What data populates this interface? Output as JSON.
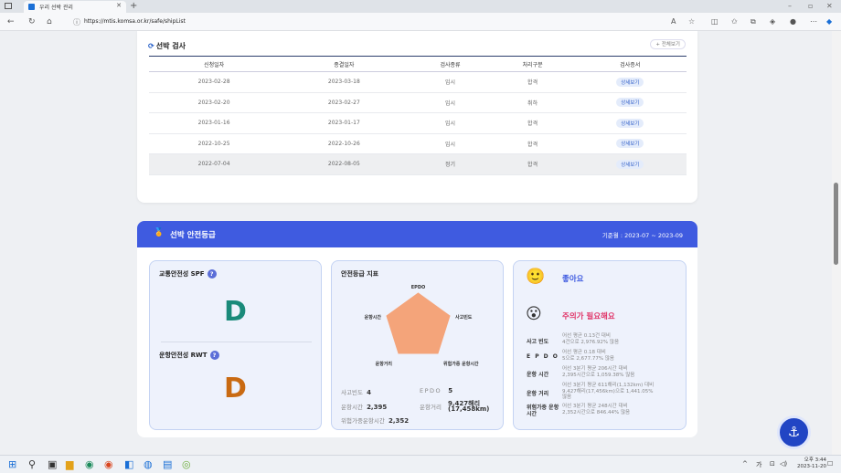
{
  "browser": {
    "tab_title": "우리 선박 관리",
    "url": "https://mtis.komsa.or.kr/safe/shipList"
  },
  "inspection": {
    "title": "선박 검사",
    "more_label": "+ 전체보기",
    "columns": [
      "신청일자",
      "종결일자",
      "검사종류",
      "처리구분",
      "검사증서"
    ],
    "rows": [
      {
        "apply": "2023-02-28",
        "close": "2023-03-18",
        "type": "임시",
        "status": "합격",
        "cert": "상세보기"
      },
      {
        "apply": "2023-02-20",
        "close": "2023-02-27",
        "type": "임시",
        "status": "취하",
        "cert": "상세보기"
      },
      {
        "apply": "2023-01-16",
        "close": "2023-01-17",
        "type": "임시",
        "status": "합격",
        "cert": "상세보기"
      },
      {
        "apply": "2022-10-25",
        "close": "2022-10-26",
        "type": "임시",
        "status": "합격",
        "cert": "상세보기"
      },
      {
        "apply": "2022-07-04",
        "close": "2022-08-05",
        "type": "정기",
        "status": "합격",
        "cert": "상세보기"
      }
    ]
  },
  "safety": {
    "title": "선박 안전등급",
    "period": "기준월 : 2023-07 ~ 2023-09",
    "spf": {
      "label": "교통안전성 SPF",
      "grade": "D",
      "help": "?"
    },
    "rwt": {
      "label": "운항안전성 RWT",
      "grade": "D",
      "help": "?"
    },
    "index": {
      "title": "안전등급 지표",
      "axes": [
        "EPDO",
        "사고빈도",
        "위험가중 운항시간",
        "운항거리",
        "운항시간"
      ],
      "stats": {
        "freq_label": "사고빈도",
        "freq": "4",
        "epdo_label": "EPDO",
        "epdo": "5",
        "hours_label": "운항시간",
        "hours": "2,395",
        "dist_label": "운항거리",
        "dist_nm": "9,427해리",
        "dist_km": "(17,458km)",
        "risk_label": "위험가중운항시간",
        "risk": "2,352"
      }
    },
    "eval": {
      "good": "좋아요",
      "caution": "주의가 필요해요",
      "details": [
        {
          "k": "사고 빈도",
          "v1": "어선 평균 0.13건 대비",
          "v2": "4건으로 2,976.92% 많음"
        },
        {
          "k": "E P D O",
          "v1": "어선 평균 0.18 대비",
          "v2": "5으로 2,677.77% 많음"
        },
        {
          "k": "운항 시간",
          "v1": "어선 3분기 평균 206시간 대비",
          "v2": "2,395시간으로 1,059.38% 많음"
        },
        {
          "k": "운항 거리",
          "v1": "어선 3분기 평균 611해리(1,132km) 대비",
          "v2": "9,427해리(17,456km)으로 1,441.05%",
          "v3": "많음"
        },
        {
          "k": "위험가중 운항시간",
          "v1": "어선 3분기 평균 248시간 대비",
          "v2": "2,352시간으로 846.44% 많음"
        }
      ]
    }
  },
  "taskbar": {
    "time": "오후 3:44",
    "date": "2023-11-20",
    "ime": "가"
  },
  "colors": {
    "primary": "#3f5be0",
    "grade_spf": "#1a8a7a",
    "grade_rwt": "#c96a12",
    "radar_fill": "#f4a47a",
    "caution": "#e03468"
  }
}
